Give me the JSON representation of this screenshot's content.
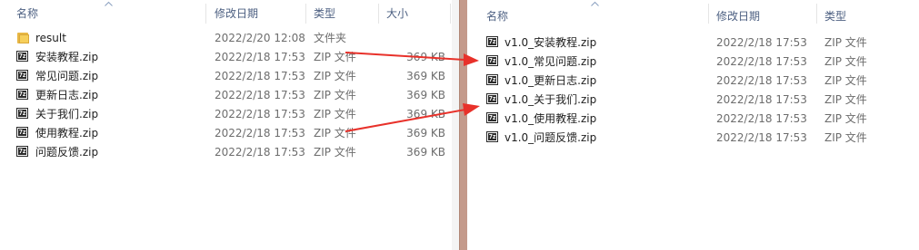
{
  "left": {
    "headers": {
      "name": "名称",
      "date": "修改日期",
      "type": "类型",
      "size": "大小"
    },
    "rows": [
      {
        "icon": "folder-icon",
        "name": "result",
        "date": "2022/2/20 12:08",
        "type": "文件夹",
        "size": ""
      },
      {
        "icon": "zip-icon",
        "name": "安装教程.zip",
        "date": "2022/2/18 17:53",
        "type": "ZIP 文件",
        "size": "369 KB"
      },
      {
        "icon": "zip-icon",
        "name": "常见问题.zip",
        "date": "2022/2/18 17:53",
        "type": "ZIP 文件",
        "size": "369 KB"
      },
      {
        "icon": "zip-icon",
        "name": "更新日志.zip",
        "date": "2022/2/18 17:53",
        "type": "ZIP 文件",
        "size": "369 KB"
      },
      {
        "icon": "zip-icon",
        "name": "关于我们.zip",
        "date": "2022/2/18 17:53",
        "type": "ZIP 文件",
        "size": "369 KB"
      },
      {
        "icon": "zip-icon",
        "name": "使用教程.zip",
        "date": "2022/2/18 17:53",
        "type": "ZIP 文件",
        "size": "369 KB"
      },
      {
        "icon": "zip-icon",
        "name": "问题反馈.zip",
        "date": "2022/2/18 17:53",
        "type": "ZIP 文件",
        "size": "369 KB"
      }
    ]
  },
  "right": {
    "headers": {
      "name": "名称",
      "date": "修改日期",
      "type": "类型"
    },
    "rows": [
      {
        "icon": "zip-icon",
        "name": "v1.0_安装教程.zip",
        "date": "2022/2/18 17:53",
        "type": "ZIP 文件"
      },
      {
        "icon": "zip-icon",
        "name": "v1.0_常见问题.zip",
        "date": "2022/2/18 17:53",
        "type": "ZIP 文件"
      },
      {
        "icon": "zip-icon",
        "name": "v1.0_更新日志.zip",
        "date": "2022/2/18 17:53",
        "type": "ZIP 文件"
      },
      {
        "icon": "zip-icon",
        "name": "v1.0_关于我们.zip",
        "date": "2022/2/18 17:53",
        "type": "ZIP 文件"
      },
      {
        "icon": "zip-icon",
        "name": "v1.0_使用教程.zip",
        "date": "2022/2/18 17:53",
        "type": "ZIP 文件"
      },
      {
        "icon": "zip-icon",
        "name": "v1.0_问题反馈.zip",
        "date": "2022/2/18 17:53",
        "type": "ZIP 文件"
      }
    ]
  },
  "zip_icon_text": "7z",
  "colors": {
    "arrow": "#e8312a",
    "header_text": "#4d6082",
    "divider": "#c49a8b"
  }
}
